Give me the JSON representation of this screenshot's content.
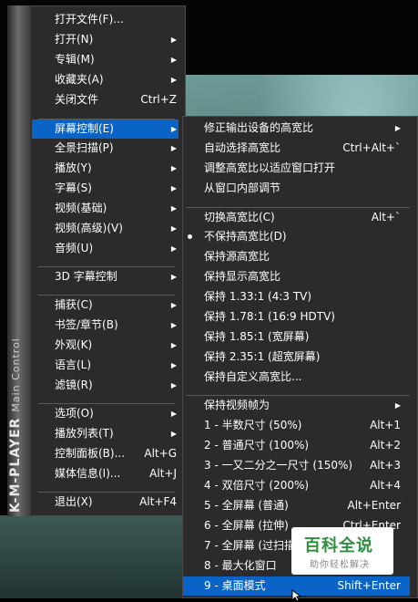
{
  "brand": {
    "name": "K-M-PLAYER",
    "subtitle": "Main Control"
  },
  "main_menu": [
    {
      "label": "打开文件(F)...",
      "shortcut": "",
      "submenu": false
    },
    {
      "label": "打开(N)",
      "shortcut": "",
      "submenu": true
    },
    {
      "label": "专辑(M)",
      "shortcut": "",
      "submenu": true
    },
    {
      "label": "收藏夹(A)",
      "shortcut": "",
      "submenu": true
    },
    {
      "label": "关闭文件",
      "shortcut": "Ctrl+Z",
      "submenu": false
    },
    {
      "label": "屏幕控制(E)",
      "shortcut": "",
      "submenu": true,
      "highlighted": true
    },
    {
      "label": "全景扫描(P)",
      "shortcut": "",
      "submenu": true
    },
    {
      "label": "播放(Y)",
      "shortcut": "",
      "submenu": true
    },
    {
      "label": "字幕(S)",
      "shortcut": "",
      "submenu": true
    },
    {
      "label": "视频(基础)",
      "shortcut": "",
      "submenu": true
    },
    {
      "label": "视频(高级)(V)",
      "shortcut": "",
      "submenu": true
    },
    {
      "label": "音频(U)",
      "shortcut": "",
      "submenu": true
    },
    {
      "label": "3D 字幕控制",
      "shortcut": "",
      "submenu": true
    },
    {
      "label": "捕获(C)",
      "shortcut": "",
      "submenu": true
    },
    {
      "label": "书签/章节(B)",
      "shortcut": "",
      "submenu": true
    },
    {
      "label": "外观(K)",
      "shortcut": "",
      "submenu": true
    },
    {
      "label": "语言(L)",
      "shortcut": "",
      "submenu": true
    },
    {
      "label": "滤镜(R)",
      "shortcut": "",
      "submenu": true
    },
    {
      "label": "选项(O)",
      "shortcut": "",
      "submenu": true
    },
    {
      "label": "播放列表(T)",
      "shortcut": "",
      "submenu": true
    },
    {
      "label": "控制面板(B)...",
      "shortcut": "Alt+G",
      "submenu": false
    },
    {
      "label": "媒体信息(I)...",
      "shortcut": "Alt+J",
      "submenu": false
    },
    {
      "label": "退出(X)",
      "shortcut": "Alt+F4",
      "submenu": false
    }
  ],
  "sub_menu": [
    {
      "label": "修正输出设备的高宽比",
      "shortcut": "",
      "submenu": true
    },
    {
      "label": "自动选择高宽比",
      "shortcut": "Ctrl+Alt+`",
      "submenu": false
    },
    {
      "label": "调整高宽比以适应窗口打开",
      "shortcut": "",
      "submenu": false
    },
    {
      "label": "从窗口内部调节",
      "shortcut": "",
      "submenu": false
    },
    {
      "label": "切换高宽比(C)",
      "shortcut": "Alt+`",
      "submenu": false
    },
    {
      "label": "不保持高宽比(D)",
      "shortcut": "",
      "submenu": false,
      "checked": true
    },
    {
      "label": "保持源高宽比",
      "shortcut": "",
      "submenu": false
    },
    {
      "label": "保持显示高宽比",
      "shortcut": "",
      "submenu": false
    },
    {
      "label": "保持 1.33:1 (4:3 TV)",
      "shortcut": "",
      "submenu": false
    },
    {
      "label": "保持 1.78:1 (16:9 HDTV)",
      "shortcut": "",
      "submenu": false
    },
    {
      "label": "保持 1.85:1 (宽屏幕)",
      "shortcut": "",
      "submenu": false
    },
    {
      "label": "保持 2.35:1 (超宽屏幕)",
      "shortcut": "",
      "submenu": false
    },
    {
      "label": "保持自定义高宽比...",
      "shortcut": "",
      "submenu": false
    },
    {
      "label": "保持视频帧为",
      "shortcut": "",
      "submenu": true
    },
    {
      "label": "1 - 半数尺寸 (50%)",
      "shortcut": "Alt+1",
      "submenu": false
    },
    {
      "label": "2 - 普通尺寸 (100%)",
      "shortcut": "Alt+2",
      "submenu": false
    },
    {
      "label": "3 - 一又二分之一尺寸 (150%)",
      "shortcut": "Alt+3",
      "submenu": false
    },
    {
      "label": "4 - 双倍尺寸 (200%)",
      "shortcut": "Alt+4",
      "submenu": false
    },
    {
      "label": "5 - 全屏幕 (普通)",
      "shortcut": "Alt+Enter",
      "submenu": false
    },
    {
      "label": "6 - 全屏幕 (拉伸)",
      "shortcut": "Ctrl+Enter",
      "submenu": false
    },
    {
      "label": "7 - 全屏幕 (过扫描)",
      "shortcut": "",
      "submenu": false
    },
    {
      "label": "8 - 最大化窗口",
      "shortcut": "",
      "submenu": false
    },
    {
      "label": "9 - 桌面模式",
      "shortcut": "Shift+Enter",
      "submenu": false,
      "highlighted": true
    }
  ],
  "watermark": {
    "title": "百科全说",
    "subtitle": "助你轻松解决"
  },
  "icons": {
    "submenu_arrow": "chevron-right-icon",
    "check": "radio-bullet-icon",
    "cursor": "mouse-pointer-icon"
  }
}
